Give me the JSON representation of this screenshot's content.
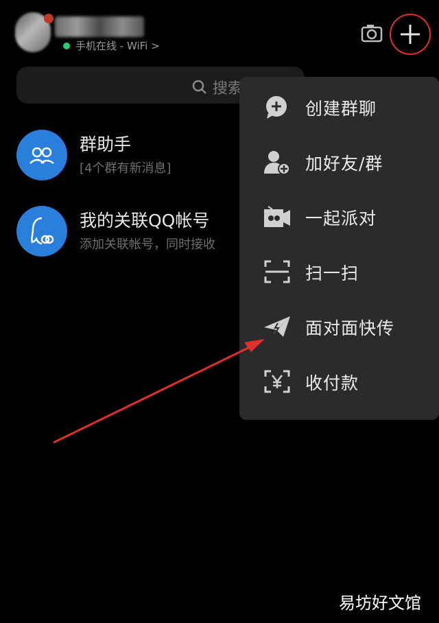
{
  "header": {
    "status_text": "手机在线 - WiFi >",
    "camera_icon": "camera-icon",
    "plus_icon": "plus-icon"
  },
  "search": {
    "placeholder": "搜索"
  },
  "list": {
    "items": [
      {
        "title": "群助手",
        "subtitle": "[4个群有新消息]",
        "icon": "group-people-icon"
      },
      {
        "title": "我的关联QQ帐号",
        "subtitle": "添加关联帐号，同时接收",
        "icon": "linked-account-icon"
      }
    ]
  },
  "menu": {
    "items": [
      {
        "label": "创建群聊",
        "icon": "create-group-chat-icon"
      },
      {
        "label": "加好友/群",
        "icon": "add-friend-icon"
      },
      {
        "label": "一起派对",
        "icon": "party-icon"
      },
      {
        "label": "扫一扫",
        "icon": "scan-icon"
      },
      {
        "label": "面对面快传",
        "icon": "paper-plane-icon"
      },
      {
        "label": "收付款",
        "icon": "payment-icon"
      }
    ]
  },
  "watermark": "易坊好文馆",
  "colors": {
    "background": "#000000",
    "menu_bg": "#2b2b2d",
    "accent_blue": "#2a7fdc",
    "highlight_red": "#e0302d",
    "online_green": "#2ecc71"
  }
}
